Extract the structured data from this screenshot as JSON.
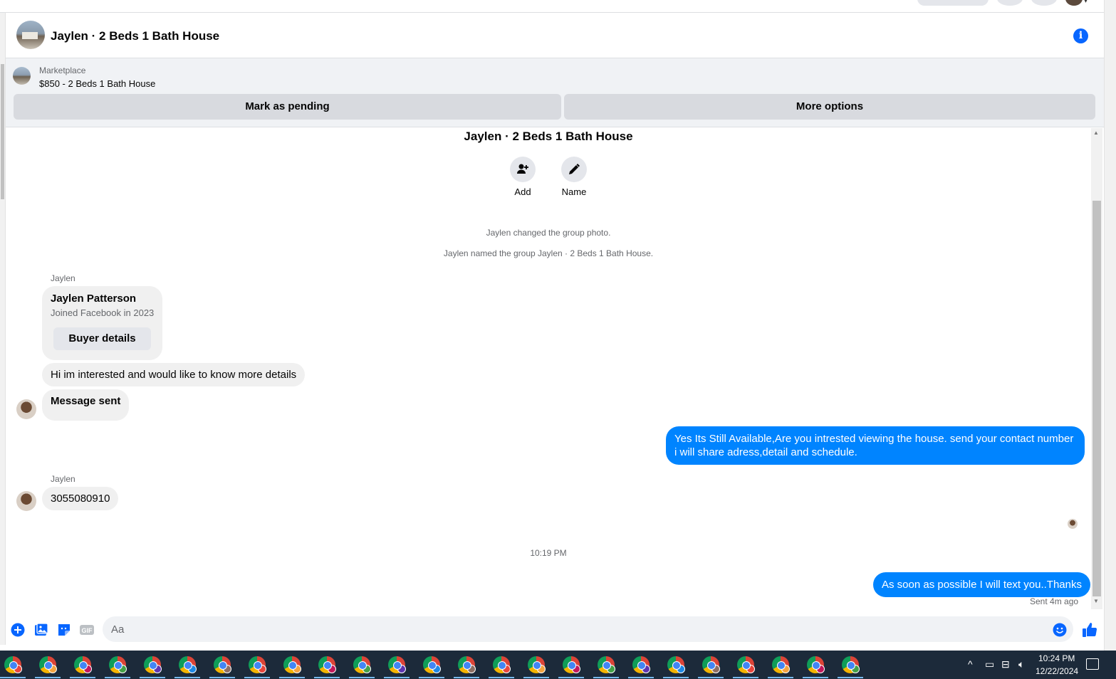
{
  "header": {
    "title": "Jaylen · 2 Beds 1 Bath House"
  },
  "marketplace": {
    "label": "Marketplace",
    "listing": "$850 - 2 Beds 1 Bath House",
    "mark_pending_label": "Mark as pending",
    "more_options_label": "More options"
  },
  "conversation": {
    "group_title": "Jaylen · 2 Beds 1 Bath House",
    "actions": [
      {
        "label": "Add",
        "icon": "add-person-icon"
      },
      {
        "label": "Name",
        "icon": "pencil-icon"
      }
    ],
    "system_messages": [
      "Jaylen changed the group photo.",
      "Jaylen named the group Jaylen · 2 Beds 1 Bath House."
    ],
    "sender_name_1": "Jaylen",
    "profile_card": {
      "name": "Jaylen Patterson",
      "joined": "Joined Facebook in 2023",
      "button_label": "Buyer details"
    },
    "msg_in_1": "Hi im interested and would like to know more details",
    "msg_in_2": "Message sent",
    "msg_out_1": "Yes Its Still Available,Are you intrested viewing the house. send your contact number i will share adress,detail and schedule.",
    "sender_name_2": "Jaylen",
    "msg_in_3": "3055080910",
    "timestamp": "10:19 PM",
    "msg_out_2": "As soon as possible I will text you..Thanks",
    "sent_status": "Sent 4m ago"
  },
  "composer": {
    "placeholder": "Aa",
    "icons": [
      "plus-icon",
      "photo-icon",
      "sticker-icon",
      "gif-icon",
      "emoji-icon",
      "like-icon"
    ],
    "gif_label": "GIF"
  },
  "taskbar": {
    "app_count": 25,
    "time": "10:24 PM",
    "date": "12/22/2024"
  },
  "colors": {
    "accent": "#0866ff",
    "outgoing_bubble": "#0084ff",
    "incoming_bubble": "#f0f0f0",
    "taskbar": "#1c2a3a"
  }
}
